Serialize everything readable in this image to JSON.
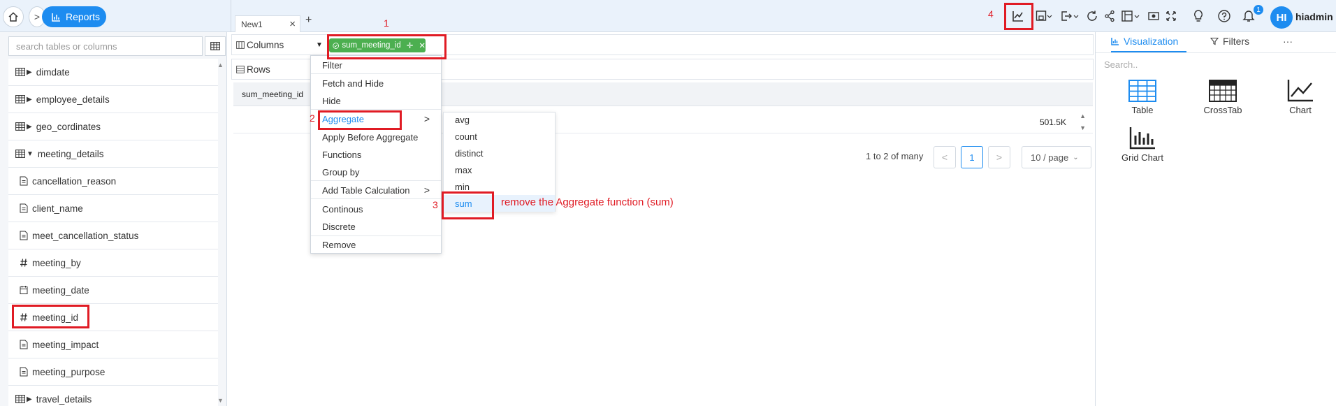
{
  "breadcrumb": {
    "chevron": ">",
    "reports_label": "Reports"
  },
  "tabs": [
    {
      "label": "New1",
      "close": "×"
    }
  ],
  "add_tab": "+",
  "topbar": {
    "icons": [
      "chart-icon",
      "save-icon",
      "export-icon",
      "refresh-icon",
      "share-icon",
      "layout-icon",
      "preview-icon",
      "expand-icon",
      "bulb-icon",
      "help-icon",
      "bell-icon"
    ],
    "notification_count": "1",
    "avatar_initials": "HI",
    "username": "hiadmin"
  },
  "left_panel": {
    "search_placeholder": "search tables or columns",
    "items": [
      {
        "label": "dimdate",
        "type": "table",
        "expanded": false
      },
      {
        "label": "employee_details",
        "type": "table",
        "expanded": false
      },
      {
        "label": "geo_cordinates",
        "type": "table",
        "expanded": false
      },
      {
        "label": "meeting_details",
        "type": "table",
        "expanded": true
      },
      {
        "label": "cancellation_reason",
        "type": "text-field"
      },
      {
        "label": "client_name",
        "type": "text-field"
      },
      {
        "label": "meet_cancellation_status",
        "type": "text-field"
      },
      {
        "label": "meeting_by",
        "type": "number-field"
      },
      {
        "label": "meeting_date",
        "type": "date-field"
      },
      {
        "label": "meeting_id",
        "type": "number-field"
      },
      {
        "label": "meeting_impact",
        "type": "text-field"
      },
      {
        "label": "meeting_purpose",
        "type": "text-field"
      },
      {
        "label": "travel_details",
        "type": "table",
        "expanded": false
      }
    ]
  },
  "shelves": {
    "columns_label": "Columns",
    "rows_label": "Rows",
    "column_pill": "sum_meeting_id"
  },
  "grid": {
    "header": "sum_meeting_id",
    "row_value": "501.5K"
  },
  "pagination": {
    "summary": "1 to 2 of many",
    "prev": "<",
    "current_page": "1",
    "next": ">",
    "per_page": "10 / page"
  },
  "context_menu": {
    "items": [
      "Filter",
      "Fetch and Hide",
      "Hide",
      "Aggregate",
      "Apply Before Aggregate",
      "Functions",
      "Group by",
      "Add Table Calculation",
      "Continous",
      "Discrete",
      "Remove"
    ],
    "submenu_arrow": ">"
  },
  "aggregate_submenu": {
    "items": [
      "avg",
      "count",
      "distinct",
      "max",
      "min",
      "sum"
    ],
    "selected": "sum"
  },
  "right_panel": {
    "tab_visualization": "Visualization",
    "tab_filters": "Filters",
    "tab_more": "···",
    "search_placeholder": "Search..",
    "viz_types": [
      "Table",
      "CrossTab",
      "Chart",
      "Grid Chart"
    ]
  },
  "annotations": {
    "n1": "1",
    "n2": "2",
    "n3": "3",
    "n4": "4",
    "note": "remove the Aggregate function (sum)",
    "color": "#e01b24"
  },
  "colors": {
    "accent": "#1d8cf0",
    "pill_green": "#4caf50",
    "annotation_red": "#e01b24"
  }
}
